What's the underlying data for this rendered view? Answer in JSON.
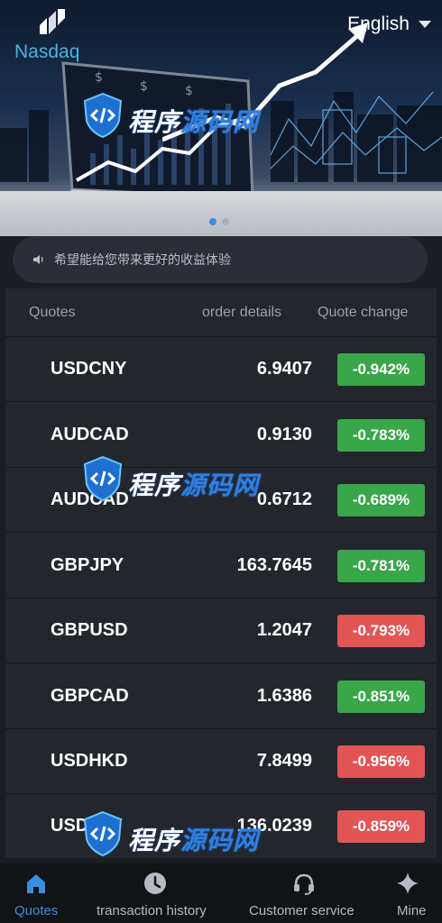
{
  "header": {
    "brand": "Nasdaq",
    "language": "English"
  },
  "carousel": {
    "slides": 2,
    "active_index": 0
  },
  "notice": {
    "text": "希望能给您带来更好的收益体验"
  },
  "quotes_table": {
    "columns": [
      "Quotes",
      "order details",
      "Quote change"
    ],
    "rows": [
      {
        "symbol": "USDCNY",
        "price": "6.9407",
        "change": "-0.942%",
        "status": "down"
      },
      {
        "symbol": "AUDCAD",
        "price": "0.9130",
        "change": "-0.783%",
        "status": "down"
      },
      {
        "symbol": "AUDCAD",
        "price": "0.6712",
        "change": "-0.689%",
        "status": "down"
      },
      {
        "symbol": "GBPJPY",
        "price": "163.7645",
        "change": "-0.781%",
        "status": "down"
      },
      {
        "symbol": "GBPUSD",
        "price": "1.2047",
        "change": "-0.793%",
        "status": "down_red"
      },
      {
        "symbol": "GBPCAD",
        "price": "1.6386",
        "change": "-0.851%",
        "status": "down"
      },
      {
        "symbol": "USDHKD",
        "price": "7.8499",
        "change": "-0.956%",
        "status": "down_red"
      },
      {
        "symbol": "USDJPY",
        "price": "136.0239",
        "change": "-0.859%",
        "status": "down_red"
      }
    ]
  },
  "colors": {
    "change_green": "#3aa64a",
    "change_red": "#e25555",
    "accent": "#3a8de0"
  },
  "watermark": {
    "text_white": "程序",
    "text_blue": "源码网"
  },
  "bottom_nav": {
    "active": "quotes",
    "items": [
      {
        "id": "quotes",
        "label": "Quotes",
        "icon": "home-icon"
      },
      {
        "id": "history",
        "label": "transaction history",
        "icon": "clock-icon"
      },
      {
        "id": "service",
        "label": "Customer service",
        "icon": "headset-icon"
      },
      {
        "id": "mine",
        "label": "Mine",
        "icon": "sparkle-icon"
      }
    ]
  }
}
